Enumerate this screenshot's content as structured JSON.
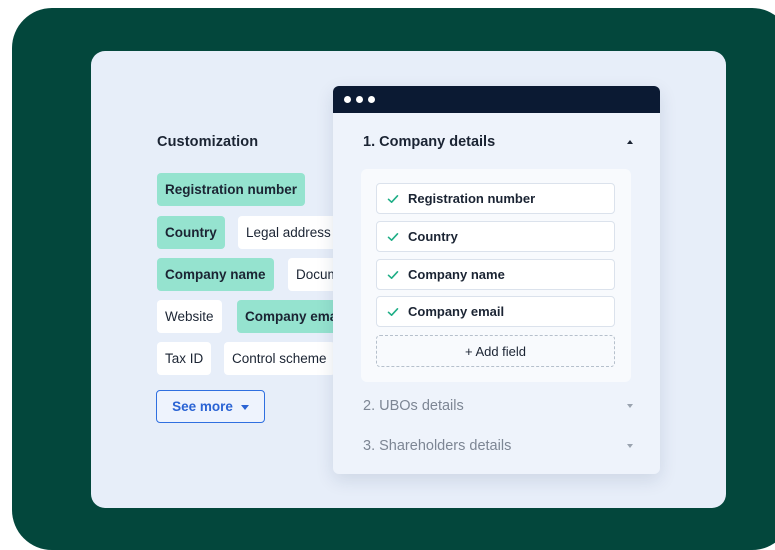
{
  "customization": {
    "title": "Customization",
    "chips": [
      {
        "label": "Registration number",
        "selected": true
      },
      {
        "label": "Country",
        "selected": true
      },
      {
        "label": "Legal address",
        "selected": false
      },
      {
        "label": "Company name",
        "selected": true
      },
      {
        "label": "Documents",
        "selected": false
      },
      {
        "label": "Website",
        "selected": false
      },
      {
        "label": "Company email",
        "selected": true
      },
      {
        "label": "Tax ID",
        "selected": false
      },
      {
        "label": "Control scheme",
        "selected": false
      }
    ],
    "see_more_label": "See more"
  },
  "window": {
    "sections": [
      {
        "title": "1. Company details",
        "expanded": true
      },
      {
        "title": "2. UBOs details",
        "expanded": false
      },
      {
        "title": "3. Shareholders details",
        "expanded": false
      }
    ],
    "fields": [
      "Registration number",
      "Country",
      "Company name",
      "Company email"
    ],
    "add_field_label": "+ Add field"
  },
  "colors": {
    "background": "#03473c",
    "panel": "#e7eef9",
    "chip_selected": "#95e3cf",
    "accent": "#2a63d4",
    "check": "#1fae86",
    "titlebar": "#0b1a33"
  }
}
